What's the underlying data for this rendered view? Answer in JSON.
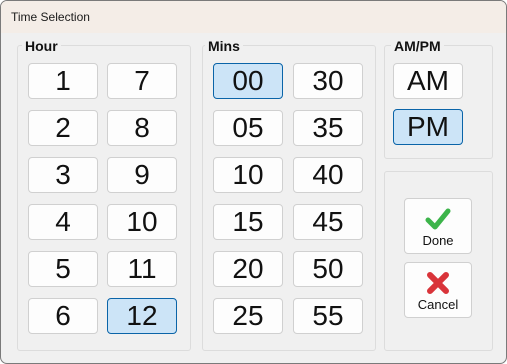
{
  "window": {
    "title": "Time Selection"
  },
  "hour": {
    "label": "Hour",
    "items": [
      "1",
      "2",
      "3",
      "4",
      "5",
      "6",
      "7",
      "8",
      "9",
      "10",
      "11",
      "12"
    ],
    "selected": "12"
  },
  "mins": {
    "label": "Mins",
    "items": [
      "00",
      "05",
      "10",
      "15",
      "20",
      "25",
      "30",
      "35",
      "40",
      "45",
      "50",
      "55"
    ],
    "selected": "00"
  },
  "ampm": {
    "label": "AM/PM",
    "items": [
      "AM",
      "PM"
    ],
    "selected": "PM"
  },
  "actions": {
    "done_label": "Done",
    "cancel_label": "Cancel"
  },
  "icons": {
    "done": "check-icon",
    "cancel": "x-icon"
  },
  "colors": {
    "selected_bg": "#cce4f7",
    "selected_border": "#0a64a8",
    "check_green": "#3cb44a",
    "cancel_red": "#d9343a"
  }
}
